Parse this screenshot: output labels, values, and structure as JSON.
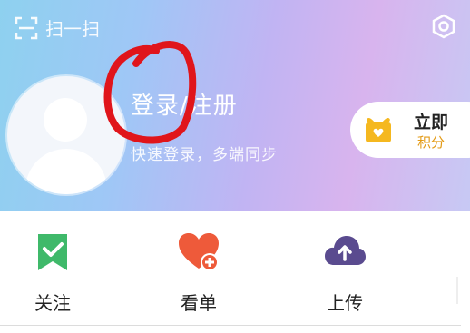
{
  "header": {
    "scan_label": "扫一扫",
    "login_title": "登录/注册",
    "login_subtitle": "快速登录，多端同步",
    "checkin_title": "立即",
    "checkin_subtitle": "积分"
  },
  "actions": [
    {
      "label": "关注",
      "icon": "check-bookmark-icon"
    },
    {
      "label": "看单",
      "icon": "heart-plus-icon"
    },
    {
      "label": "上传",
      "icon": "cloud-upload-icon"
    }
  ],
  "colors": {
    "follow_green": "#3fb96a",
    "heart_red": "#ee5a3a",
    "cloud_purple": "#5a4b8f",
    "annotation_red": "#e0151b",
    "gift_yellow": "#f5b81f"
  }
}
